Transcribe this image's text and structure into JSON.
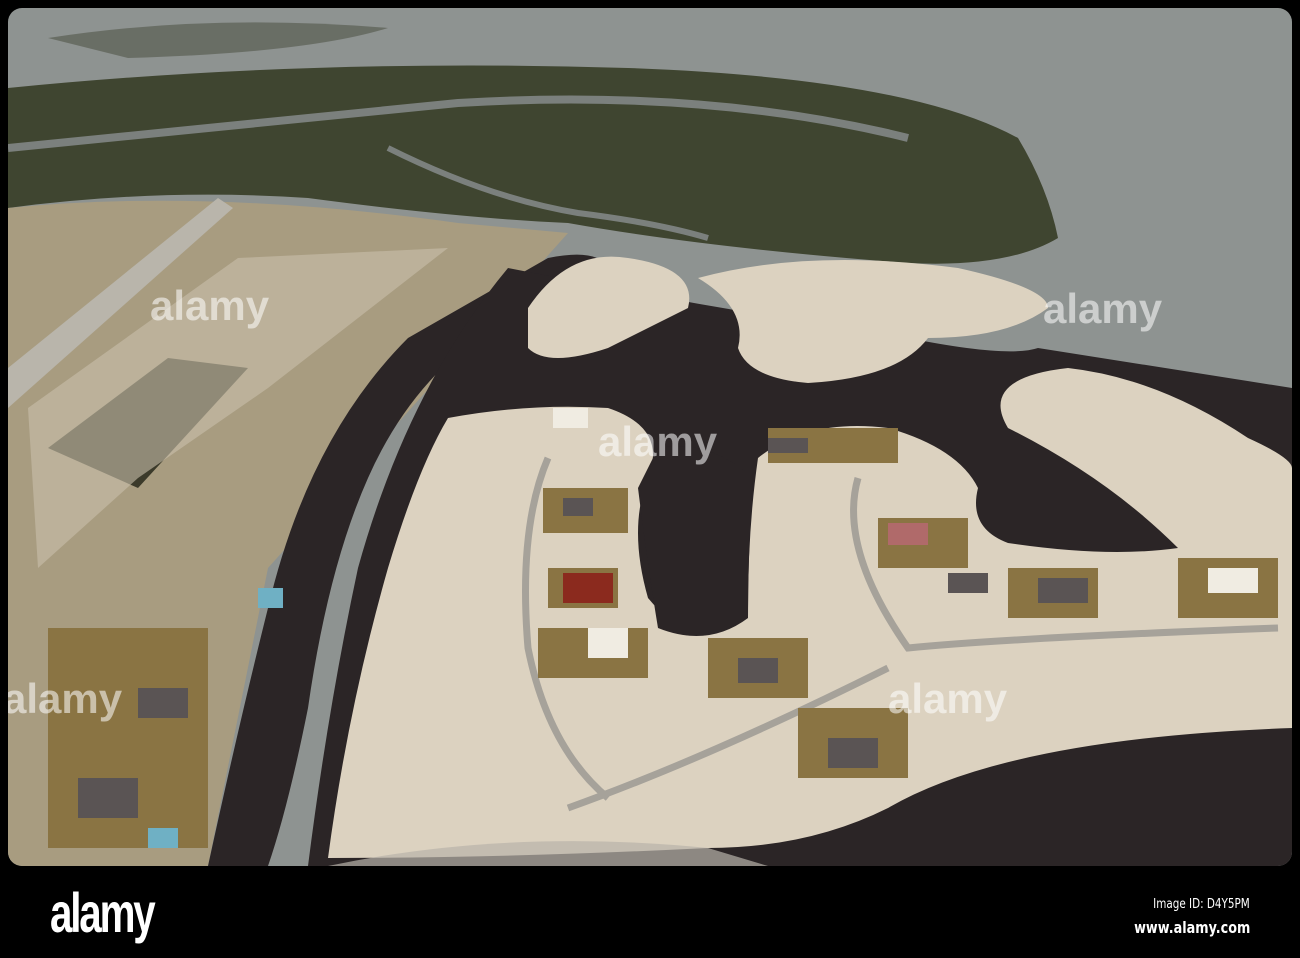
{
  "photo": {
    "subject": "aerial-view-canal-housing-development",
    "watermark_text": "alamy",
    "colors": {
      "sea": "#8e9391",
      "mangrove": "#3f4530",
      "sand": "#dcd2c0",
      "canal": "#2b2526",
      "lawn": "#8a7443"
    }
  },
  "footer": {
    "logo": "alamy",
    "image_id": "Image ID: D4Y5PM",
    "website": "www.alamy.com"
  }
}
